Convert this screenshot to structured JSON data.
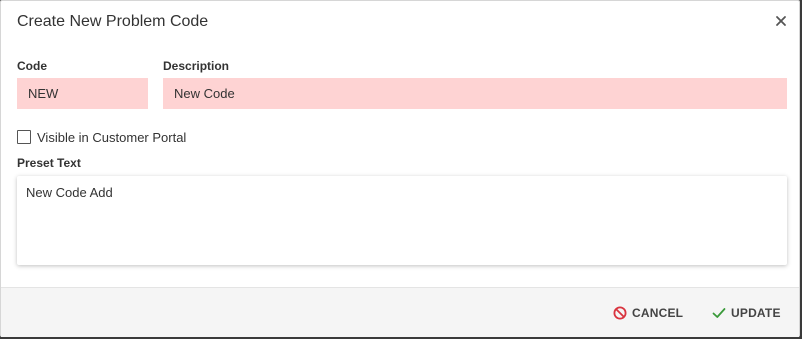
{
  "dialog": {
    "title": "Create New Problem Code",
    "close_icon": "close-icon"
  },
  "form": {
    "code_label": "Code",
    "code_value": "NEW",
    "description_label": "Description",
    "description_value": "New Code",
    "visible_label": "Visible in Customer Portal",
    "visible_checked": false,
    "preset_label": "Preset Text",
    "preset_value": "New Code Add",
    "required_field_color": "#fed3d3"
  },
  "footer": {
    "cancel_label": "CANCEL",
    "cancel_icon": "ban-icon",
    "cancel_icon_color": "#d9343f",
    "update_label": "UPDATE",
    "update_icon": "check-icon",
    "update_icon_color": "#3a9a3a"
  }
}
